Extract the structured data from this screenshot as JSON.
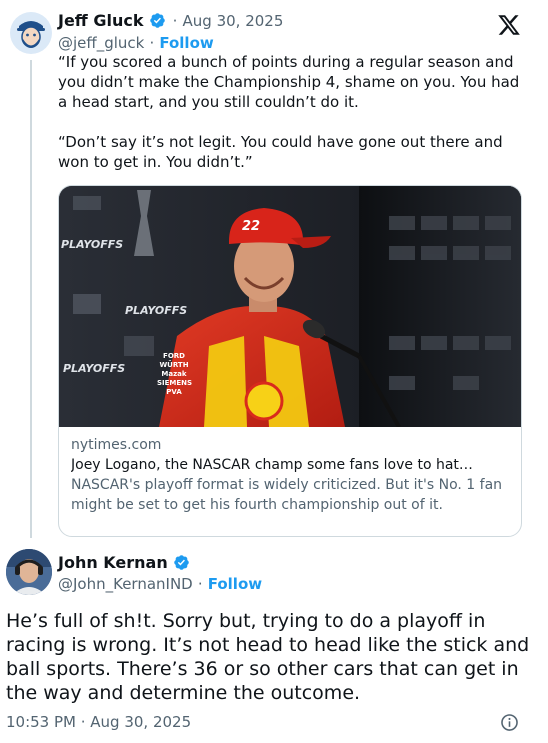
{
  "quoted_tweet": {
    "author_name": "Jeff Gluck",
    "date": "Aug 30, 2025",
    "handle": "@jeff_gluck",
    "follow_label": "Follow",
    "paragraphs": [
      "“If you scored a bunch of points during a regular season and you didn’t make the Championship 4, shame on you. You had a head start, and you still couldn’t do it.",
      "“Don’t say it’s not legit. You could have gone out there and won to get in. You didn’t.”"
    ],
    "link_card": {
      "domain": "nytimes.com",
      "title": "Joey Logano, the NASCAR champ some fans love to hat…",
      "description": "NASCAR's playoff format is widely criticized. But it's No. 1 fan might be set to get his fourth championship out of it.",
      "backdrop_labels": [
        "PLAYOFFS",
        "PLAYOFFS",
        "PLAYOFFS"
      ],
      "cap_number": "22",
      "patches": [
        "FORD",
        "WÜRTH",
        "Mazak",
        "SIEMENS",
        "PVA"
      ]
    }
  },
  "main_tweet": {
    "author_name": "John Kernan",
    "handle": "@John_KernanIND",
    "follow_label": "Follow",
    "text": "He’s full of sh!t. Sorry but, trying to do a playoff in racing is wrong. It’s not head to head like the stick and ball sports. There’s 36 or so other cars that can get in the way and determine the outcome.",
    "timestamp": "10:53 PM · Aug 30, 2025"
  },
  "icons": {
    "verified": "verified-badge-icon",
    "x_logo": "x-logo-icon",
    "info": "info-icon"
  },
  "colors": {
    "accent": "#1d9bf0",
    "muted": "#536471",
    "border": "#cfd9de"
  }
}
